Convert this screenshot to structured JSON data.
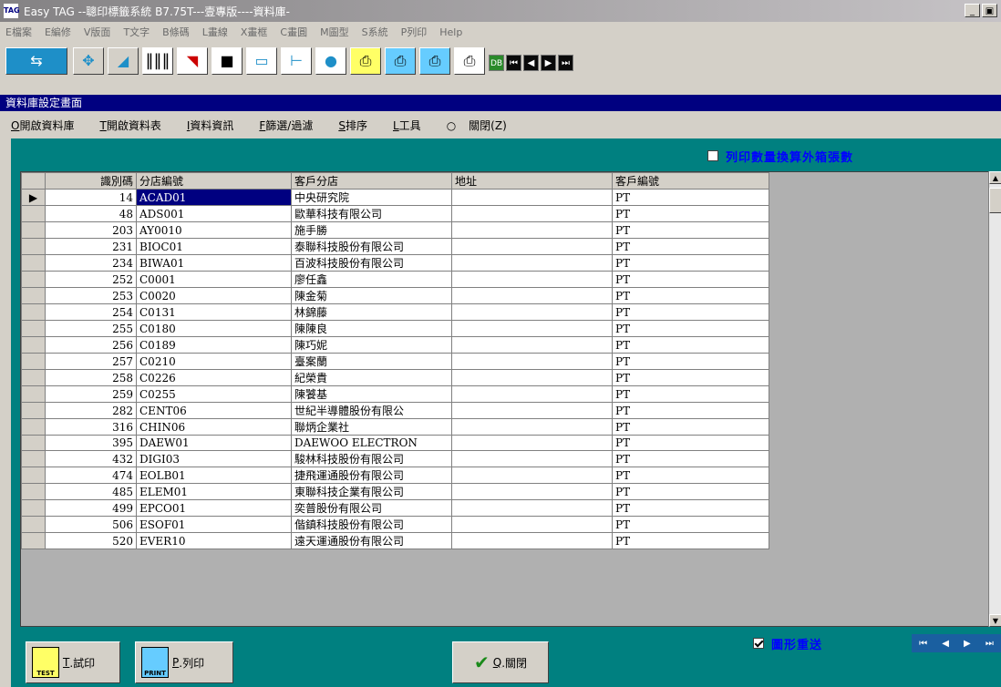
{
  "window": {
    "app_icon": "TAG",
    "title": "Easy TAG --聰印標籤系統 B7.75T---壹專版----資料庫-",
    "min_label": "_",
    "max_label": "▣"
  },
  "menubar": [
    "E檔案",
    "E編修",
    "V版面",
    "T文字",
    "B條碼",
    "L畫線",
    "X畫框",
    "C畫圓",
    "M圖型",
    "S系統",
    "P列印",
    "Help"
  ],
  "toolbar": {
    "icons": [
      "open-file-icon",
      "save-file-icon",
      "move-icon",
      "csv-import-icon",
      "barcode-icon",
      "picture-icon",
      "filled-box-icon",
      "rectangle-icon",
      "line-icon",
      "shapes-icon",
      "test-print-icon",
      "print-icon",
      "set-icon",
      "database-icon"
    ],
    "db_label": "DB",
    "nav": [
      "⏮",
      "◀",
      "▶",
      "⏭"
    ]
  },
  "section_title": "資料庫設定畫面",
  "submenu": [
    {
      "key": "O",
      "label": "開啟資料庫"
    },
    {
      "key": "T",
      "label": "開啟資料表"
    },
    {
      "key": "I",
      "label": "資料資訊"
    },
    {
      "key": "F",
      "label": "篩選/過濾"
    },
    {
      "key": "S",
      "label": "排序"
    },
    {
      "key": "L",
      "label": "工具"
    },
    {
      "key": "○",
      "label": "關閉(Z)"
    }
  ],
  "top_option": {
    "label": "列印數量換算外箱張數",
    "checked": false
  },
  "table": {
    "columns": [
      "",
      "識別碼",
      "分店編號",
      "客戶分店",
      "地址",
      "客戶編號"
    ],
    "rows": [
      [
        "▶",
        "14",
        "ACAD01",
        "中央研究院",
        "",
        "PT"
      ],
      [
        "",
        "48",
        "ADS001",
        "歐華科技有限公司",
        "",
        "PT"
      ],
      [
        "",
        "203",
        "AY0010",
        "施手勝",
        "",
        "PT"
      ],
      [
        "",
        "231",
        "BIOC01",
        "泰聯科技股份有限公司",
        "",
        "PT"
      ],
      [
        "",
        "234",
        "BIWA01",
        "百波科技股份有限公司",
        "",
        "PT"
      ],
      [
        "",
        "252",
        "C0001",
        "廖任鑫",
        "",
        "PT"
      ],
      [
        "",
        "253",
        "C0020",
        "陳金菊",
        "",
        "PT"
      ],
      [
        "",
        "254",
        "C0131",
        "林錦藤",
        "",
        "PT"
      ],
      [
        "",
        "255",
        "C0180",
        "陳陳良",
        "",
        "PT"
      ],
      [
        "",
        "256",
        "C0189",
        "陳巧妮",
        "",
        "PT"
      ],
      [
        "",
        "257",
        "C0210",
        "臺案蘭",
        "",
        "PT"
      ],
      [
        "",
        "258",
        "C0226",
        "紀榮貴",
        "",
        "PT"
      ],
      [
        "",
        "259",
        "C0255",
        "陳饕基",
        "",
        "PT"
      ],
      [
        "",
        "282",
        "CENT06",
        "世紀半導體股份有限公",
        "",
        "PT"
      ],
      [
        "",
        "316",
        "CHIN06",
        "聯炳企業社",
        "",
        "PT"
      ],
      [
        "",
        "395",
        "DAEW01",
        "DAEWOO ELECTRON",
        "",
        "PT"
      ],
      [
        "",
        "432",
        "DIGI03",
        "駿林科技股份有限公司",
        "",
        "PT"
      ],
      [
        "",
        "474",
        "EOLB01",
        "捷飛運通股份有限公司",
        "",
        "PT"
      ],
      [
        "",
        "485",
        "ELEM01",
        "東聯科技企業有限公司",
        "",
        "PT"
      ],
      [
        "",
        "499",
        "EPCO01",
        "奕普股份有限公司",
        "",
        "PT"
      ],
      [
        "",
        "506",
        "ESOF01",
        "偕鎮科技股份有限公司",
        "",
        "PT"
      ],
      [
        "",
        "520",
        "EVER10",
        "遠天運通股份有限公司",
        "",
        "PT"
      ]
    ]
  },
  "buttons": {
    "test": {
      "key": "T",
      "label": ".試印",
      "icon_text": "TEST"
    },
    "print": {
      "key": "P",
      "label": ".列印",
      "icon_text": "PRINT"
    },
    "close": {
      "key": "Q",
      "label": ".關閉"
    }
  },
  "bottom_option": {
    "label": "圖形重送",
    "checked": true
  },
  "bottom_nav": [
    "⏮",
    "◀",
    "▶",
    "⏭"
  ],
  "colors": {
    "titlebar": "#848284",
    "section": "#000080",
    "panel": "#008080",
    "accent_text": "#0000ff"
  }
}
